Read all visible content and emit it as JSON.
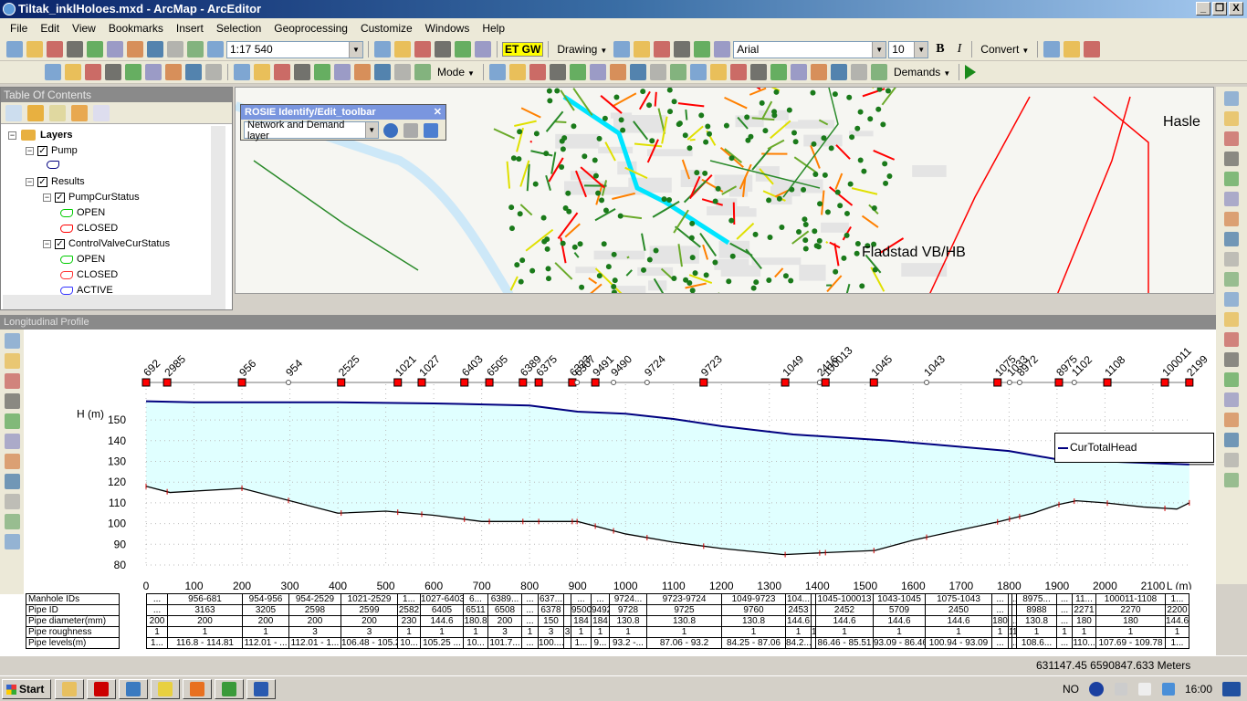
{
  "window": {
    "title": "Tiltak_inklHoloes.mxd - ArcMap - ArcEditor",
    "minimize": "_",
    "restore": "❐",
    "close": "X"
  },
  "menu": [
    "File",
    "Edit",
    "View",
    "Bookmarks",
    "Insert",
    "Selection",
    "Geoprocessing",
    "Customize",
    "Windows",
    "Help"
  ],
  "toolbar1": {
    "icons_a": [
      "new-document-icon",
      "open-folder-icon",
      "save-icon",
      "print-icon",
      "cut-icon",
      "copy-icon",
      "paste-icon",
      "delete-icon",
      "undo-icon",
      "redo-icon",
      "add-data-icon"
    ],
    "scale": "1:17 540",
    "icons_b": [
      "editor-icon",
      "table-icon",
      "catalog-icon",
      "search-window-icon",
      "toolbox-icon",
      "python-icon"
    ],
    "etgw": "ET GW",
    "drawing_label": "Drawing",
    "icons_c": [
      "select-elements-icon",
      "rotate-icon",
      "zoom-elements-icon",
      "rectangle-icon",
      "callout-icon",
      "polygon-icon"
    ],
    "font": "Arial",
    "font_size": "10",
    "bold": "B",
    "italic": "I",
    "convert_label": "Convert",
    "icons_d": [
      "magic-wand-icon",
      "i-tool-icon",
      "e-tool-icon"
    ]
  },
  "toolbar2": {
    "icons_a": [
      "profile-tool-icon",
      "profile-list-icon",
      "profile-report-icon",
      "disabled-tool-icon",
      "disabled-tool2-icon",
      "window-icon",
      "zoom-network-icon",
      "profile-delete-icon",
      "checklist-icon"
    ],
    "icons_b": [
      "open-network-icon",
      "trace-icon",
      "node-icon",
      "erase-icon",
      "c-tool-icon",
      "flow-icon",
      "frame-icon",
      "info-icon",
      "chart-icon",
      "profile-window-icon"
    ],
    "mode_label": "Mode",
    "icons_c": [
      "key-icon",
      "link-icon",
      "new-file-icon",
      "folder-icon",
      "delete-x-icon",
      "edit-icon",
      "windows-icon",
      "scissors-icon",
      "up-icon",
      "down-icon",
      "pencil-icon",
      "pen-icon",
      "map-icon",
      "gear-icon",
      "report-icon",
      "users-icon",
      "globe-help-icon",
      "sketch-icon",
      "bottle-icon",
      "swap-icon"
    ],
    "demands_label": "Demands",
    "run_icon": "play-icon"
  },
  "toc": {
    "title": "Table Of Contents",
    "items": [
      {
        "label": "Layers",
        "level": 0,
        "bold": true
      },
      {
        "label": "Pump",
        "level": 1,
        "check": true
      },
      {
        "label": "",
        "level": 2,
        "symbol": "pump-symbol-icon",
        "color": "#000080"
      },
      {
        "label": "Results",
        "level": 1,
        "check": true
      },
      {
        "label": "PumpCurStatus",
        "level": 2,
        "check": true
      },
      {
        "label": "OPEN",
        "level": 3,
        "symbol": "pump-symbol-icon",
        "color": "#00cc00"
      },
      {
        "label": "CLOSED",
        "level": 3,
        "symbol": "pump-symbol-icon",
        "color": "#ff0000"
      },
      {
        "label": "ControlValveCurStatus",
        "level": 2,
        "check": true
      },
      {
        "label": "OPEN",
        "level": 3,
        "symbol": "valve-symbol-icon",
        "color": "#00cc00"
      },
      {
        "label": "CLOSED",
        "level": 3,
        "symbol": "valve-symbol-icon",
        "color": "#ff3333"
      },
      {
        "label": "ACTIVE",
        "level": 3,
        "symbol": "valve-symbol-icon",
        "color": "#3333ff"
      }
    ]
  },
  "map": {
    "labels": [
      "Fladstad VB/HB",
      "Hasle"
    ]
  },
  "rosie": {
    "title": "ROSIE Identify/Edit_toolbar",
    "layer_select": "Network and Demand layer",
    "close": "✕"
  },
  "profile": {
    "title": "Longitudinal Profile",
    "legend": "CurTotalHead",
    "colors": {
      "head": "#00007f",
      "fill": "#e0ffff",
      "ground": "#000000",
      "node": "#ff0000"
    },
    "row_labels": [
      "Manhole IDs",
      "Pipe ID",
      "Pipe diameter(mm)",
      "Pipe roughness",
      "Pipe levels(m)"
    ],
    "columns": [
      [
        "...",
        "...",
        "200",
        "1",
        "1..."
      ],
      [
        "956-681",
        "3163",
        "200",
        "1",
        "116.8 - 114.81"
      ],
      [
        "954-956",
        "3205",
        "200",
        "1",
        "112.01 - ..."
      ],
      [
        "954-2529",
        "2598",
        "200",
        "3",
        "112.01 - 1..."
      ],
      [
        "1021-2529",
        "2599",
        "200",
        "3",
        "106.48 - 105.27"
      ],
      [
        "1...",
        "2582",
        "230",
        "1",
        "10..."
      ],
      [
        "1027-6403",
        "6405",
        "144.6",
        "1",
        "105.25 ..."
      ],
      [
        "6...",
        "6511",
        "180.8",
        "1",
        "10..."
      ],
      [
        "6389...",
        "6508",
        "200",
        "3",
        "101.7..."
      ],
      [
        "...",
        "...",
        "...",
        "1",
        "..."
      ],
      [
        "637...",
        "6378",
        "150",
        "3",
        "100...."
      ],
      [
        "",
        "",
        "",
        "3",
        ""
      ],
      [
        "...",
        "9500",
        "184",
        "1",
        "1..."
      ],
      [
        "...",
        "9492",
        "184",
        "1",
        "9..."
      ],
      [
        "9724...",
        "9728",
        "130.8",
        "1",
        "93.2 -..."
      ],
      [
        "9723-9724",
        "9725",
        "130.8",
        "1",
        "87.06 - 93.2"
      ],
      [
        "1049-9723",
        "9760",
        "130.8",
        "1",
        "84.25 - 87.06"
      ],
      [
        "104...",
        "2453",
        "144.6",
        "1",
        "84.2..."
      ],
      [
        "",
        "",
        "",
        "1",
        ""
      ],
      [
        "1045-100013",
        "2452",
        "144.6",
        "1",
        "86.46 - 85.51"
      ],
      [
        "1043-1045",
        "5709",
        "144.6",
        "1",
        "93.09 - 86.46"
      ],
      [
        "1075-1043",
        "2450",
        "144.6",
        "1",
        "100.94 - 93.09"
      ],
      [
        "...",
        "...",
        "180",
        "1",
        "..."
      ],
      [
        "",
        "",
        "",
        "1",
        ""
      ],
      [
        "...",
        "",
        "...",
        "1",
        "..."
      ],
      [
        "8975...",
        "8988",
        "130.8",
        "1",
        "108.6..."
      ],
      [
        "...",
        "...",
        "...",
        "1",
        "..."
      ],
      [
        "11...",
        "2271",
        "180",
        "1",
        "110..."
      ],
      [
        "100011-1108",
        "2270",
        "180",
        "1",
        "107.69 - 109.78"
      ],
      [
        "1...",
        "2200",
        "144.6",
        "1",
        "1..."
      ]
    ]
  },
  "chart_data": {
    "type": "line",
    "ylabel": "H (m)",
    "xlabel": "L (m)",
    "xlim": [
      0,
      2200
    ],
    "ylim": [
      80,
      160
    ],
    "xticks": [
      0,
      100,
      200,
      300,
      400,
      500,
      600,
      700,
      800,
      900,
      1000,
      1100,
      1200,
      1300,
      1400,
      1500,
      1600,
      1700,
      1800,
      1900,
      2000,
      2100
    ],
    "yticks": [
      80,
      90,
      100,
      110,
      120,
      130,
      140,
      150
    ],
    "grid": true,
    "legend_placement": "right",
    "series": [
      {
        "name": "CurTotalHead",
        "x": [
          0,
          100,
          400,
          600,
          800,
          850,
          900,
          1000,
          1100,
          1200,
          1350,
          1550,
          1800,
          1900,
          2000,
          2176
        ],
        "y": [
          159,
          158.5,
          158.5,
          158,
          157,
          155.5,
          154,
          153,
          150.5,
          147,
          143,
          140,
          135,
          131,
          130,
          128.5
        ]
      },
      {
        "x": [
          0,
          50,
          200,
          400,
          500,
          600,
          700,
          800,
          900,
          1000,
          1100,
          1200,
          1330,
          1420,
          1520,
          1600,
          1700,
          1780,
          1850,
          1900,
          1940,
          2000,
          2080,
          2150,
          2176
        ],
        "y": [
          118,
          115,
          117,
          105,
          106,
          104,
          101,
          101,
          101,
          95,
          91,
          88,
          85,
          86,
          87,
          92,
          97,
          101,
          105,
          109,
          111,
          110,
          108,
          107,
          110
        ]
      }
    ],
    "nodes": [
      {
        "id": "692",
        "x": 0,
        "t": "sq"
      },
      {
        "id": "2985",
        "x": 44,
        "t": "sq"
      },
      {
        "id": "956",
        "x": 200,
        "t": "sq"
      },
      {
        "id": "954",
        "x": 297,
        "t": "c"
      },
      {
        "id": "2525",
        "x": 407,
        "t": "sq"
      },
      {
        "id": "1021",
        "x": 525,
        "t": "sq"
      },
      {
        "id": "1027",
        "x": 575,
        "t": "sq"
      },
      {
        "id": "6403",
        "x": 664,
        "t": "sq"
      },
      {
        "id": "6505",
        "x": 716,
        "t": "sq"
      },
      {
        "id": "6389",
        "x": 786,
        "t": "sq"
      },
      {
        "id": "6375",
        "x": 819,
        "t": "sq"
      },
      {
        "id": "6323",
        "x": 889,
        "t": "sq"
      },
      {
        "id": "6307",
        "x": 899,
        "t": "c"
      },
      {
        "id": "9491",
        "x": 937,
        "t": "sq"
      },
      {
        "id": "9490",
        "x": 975,
        "t": "c"
      },
      {
        "id": "9724",
        "x": 1045,
        "t": "c"
      },
      {
        "id": "9723",
        "x": 1163,
        "t": "sq"
      },
      {
        "id": "1049",
        "x": 1333,
        "t": "sq"
      },
      {
        "id": "2416",
        "x": 1405,
        "t": "c"
      },
      {
        "id": "100013",
        "x": 1417,
        "t": "sq"
      },
      {
        "id": "1045",
        "x": 1518,
        "t": "sq"
      },
      {
        "id": "1043",
        "x": 1628,
        "t": "c"
      },
      {
        "id": "1075",
        "x": 1776,
        "t": "sq"
      },
      {
        "id": "1033",
        "x": 1801,
        "t": "c"
      },
      {
        "id": "8972",
        "x": 1822,
        "t": "c"
      },
      {
        "id": "8975",
        "x": 1904,
        "t": "sq"
      },
      {
        "id": "1102",
        "x": 1936,
        "t": "c"
      },
      {
        "id": "1108",
        "x": 2005,
        "t": "sq"
      },
      {
        "id": "100011",
        "x": 2125,
        "t": "sq"
      },
      {
        "id": "2199",
        "x": 2176,
        "t": "sq"
      }
    ]
  },
  "status": {
    "coords": "631147.45  6590847.633 Meters"
  },
  "taskbar": {
    "start": "Start",
    "apps": [
      "explorer-icon",
      "acrobat-icon",
      "arcmap-icon",
      "arccatalog-icon",
      "outlook-icon",
      "chrome-icon",
      "word-icon"
    ],
    "lang": "NO",
    "time": "16:00"
  }
}
